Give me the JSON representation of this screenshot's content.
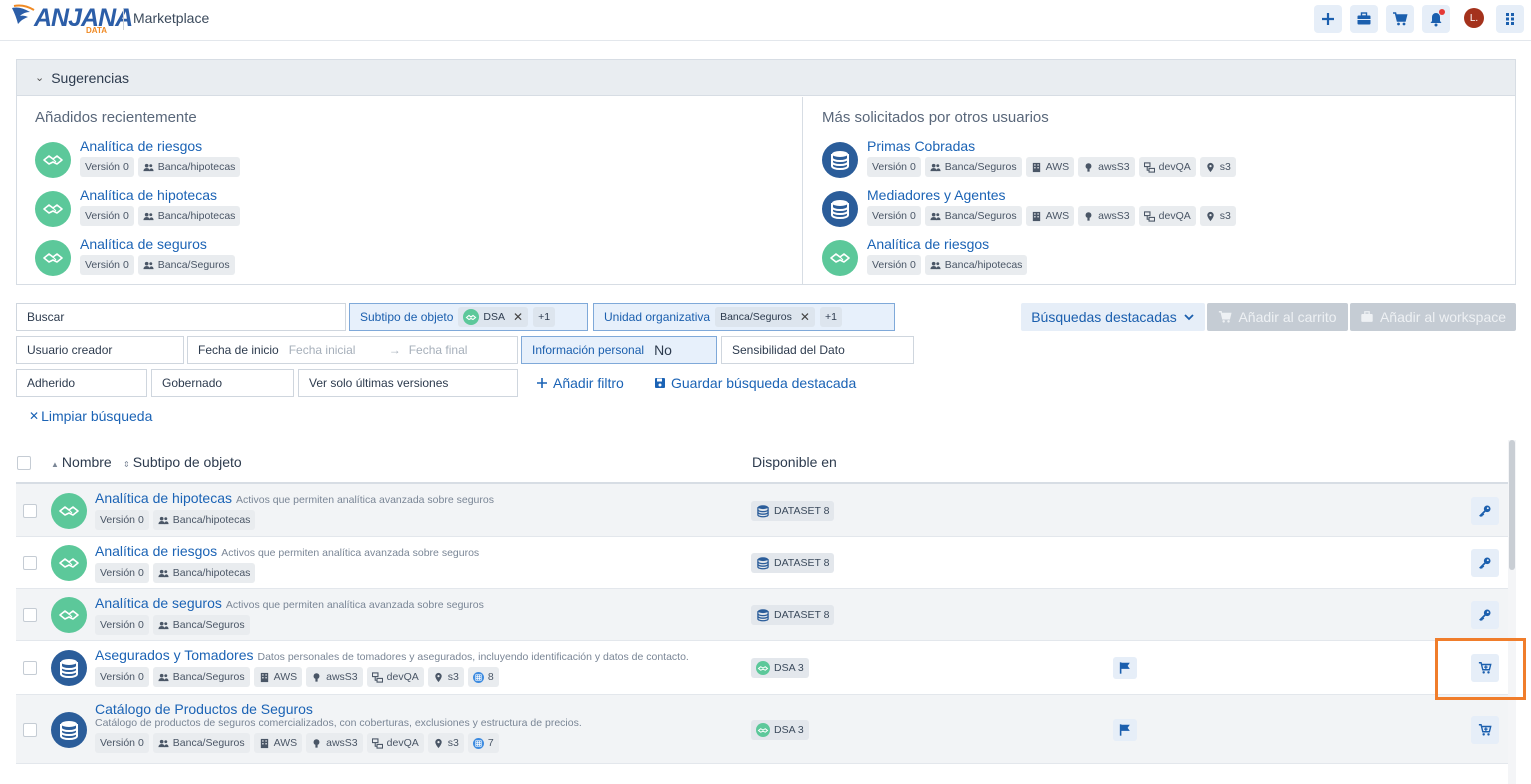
{
  "header": {
    "logo_text": "ANJANA",
    "logo_sub": "DATA",
    "app_title": "Marketplace",
    "avatar_initial": "L."
  },
  "suggestions": {
    "heading": "Sugerencias",
    "recent": {
      "title": "Añadidos recientemente",
      "items": [
        {
          "name": "Analítica de riesgos",
          "icon": "handshake-icon",
          "chips": [
            {
              "icon": "",
              "text": "Versión 0"
            },
            {
              "icon": "group-icon",
              "text": "Banca/hipotecas"
            }
          ]
        },
        {
          "name": "Analítica de hipotecas",
          "icon": "handshake-icon",
          "chips": [
            {
              "icon": "",
              "text": "Versión 0"
            },
            {
              "icon": "group-icon",
              "text": "Banca/hipotecas"
            }
          ]
        },
        {
          "name": "Analítica de seguros",
          "icon": "handshake-icon",
          "chips": [
            {
              "icon": "",
              "text": "Versión 0"
            },
            {
              "icon": "group-icon",
              "text": "Banca/Seguros"
            }
          ]
        }
      ]
    },
    "popular": {
      "title": "Más solicitados por otros usuarios",
      "items": [
        {
          "name": "Primas Cobradas",
          "icon": "database-icon",
          "chips": [
            {
              "icon": "",
              "text": "Versión 0"
            },
            {
              "icon": "group-icon",
              "text": "Banca/Seguros"
            },
            {
              "icon": "building-icon",
              "text": "AWS"
            },
            {
              "icon": "bulb-icon",
              "text": "awsS3"
            },
            {
              "icon": "network-icon",
              "text": "devQA"
            },
            {
              "icon": "pin-icon",
              "text": "s3"
            }
          ]
        },
        {
          "name": "Mediadores y Agentes",
          "icon": "database-icon",
          "chips": [
            {
              "icon": "",
              "text": "Versión 0"
            },
            {
              "icon": "group-icon",
              "text": "Banca/Seguros"
            },
            {
              "icon": "building-icon",
              "text": "AWS"
            },
            {
              "icon": "bulb-icon",
              "text": "awsS3"
            },
            {
              "icon": "network-icon",
              "text": "devQA"
            },
            {
              "icon": "pin-icon",
              "text": "s3"
            }
          ]
        },
        {
          "name": "Analítica de riesgos",
          "icon": "handshake-icon",
          "chips": [
            {
              "icon": "",
              "text": "Versión 0"
            },
            {
              "icon": "group-icon",
              "text": "Banca/hipotecas"
            }
          ]
        }
      ]
    }
  },
  "filters": {
    "search": "Buscar",
    "subtype": {
      "label": "Subtipo de objeto",
      "value": "DSA",
      "more": "+1"
    },
    "org_unit": {
      "label": "Unidad organizativa",
      "value": "Banca/Seguros",
      "more": "+1"
    },
    "creator": "Usuario creador",
    "start_date": {
      "label": "Fecha de inicio",
      "from_placeholder": "Fecha inicial",
      "arrow": "→",
      "to_placeholder": "Fecha final"
    },
    "personal_info": {
      "label": "Información personal",
      "value": "No"
    },
    "sensitivity": "Sensibilidad del Dato",
    "adhered": "Adherido",
    "governed": "Gobernado",
    "latest_versions": "Ver solo últimas versiones",
    "add_filter": "Añadir filtro",
    "save_search": "Guardar búsqueda destacada",
    "clear_search": "Limpiar búsqueda"
  },
  "actions": {
    "featured": "Búsquedas destacadas",
    "add_cart": "Añadir al carrito",
    "add_workspace": "Añadir al workspace"
  },
  "table": {
    "columns": {
      "name": "Nombre",
      "subtype": "Subtipo de objeto",
      "available": "Disponible en"
    },
    "rows": [
      {
        "name": "Analítica de hipotecas",
        "desc": "Activos que permiten analítica avanzada sobre seguros",
        "icon": "handshake-icon",
        "chips": [
          {
            "icon": "",
            "text": "Versión 0"
          },
          {
            "icon": "group-icon",
            "text": "Banca/hipotecas"
          }
        ],
        "available": "DATASET 8",
        "avail_icon": "database-icon",
        "flag": false,
        "action": "key-icon"
      },
      {
        "name": "Analítica de riesgos",
        "desc": "Activos que permiten analítica avanzada sobre seguros",
        "icon": "handshake-icon",
        "chips": [
          {
            "icon": "",
            "text": "Versión 0"
          },
          {
            "icon": "group-icon",
            "text": "Banca/hipotecas"
          }
        ],
        "available": "DATASET 8",
        "avail_icon": "database-icon",
        "flag": false,
        "action": "key-icon"
      },
      {
        "name": "Analítica de seguros",
        "desc": "Activos que permiten analítica avanzada sobre seguros",
        "icon": "handshake-icon",
        "chips": [
          {
            "icon": "",
            "text": "Versión 0"
          },
          {
            "icon": "group-icon",
            "text": "Banca/Seguros"
          }
        ],
        "available": "DATASET 8",
        "avail_icon": "database-icon",
        "flag": false,
        "action": "key-icon"
      },
      {
        "name": "Asegurados y Tomadores",
        "desc": "Datos personales de tomadores y asegurados, incluyendo identificación y datos de contacto.",
        "icon": "database-icon",
        "chips": [
          {
            "icon": "",
            "text": "Versión 0"
          },
          {
            "icon": "group-icon",
            "text": "Banca/Seguros"
          },
          {
            "icon": "building-icon",
            "text": "AWS"
          },
          {
            "icon": "bulb-icon",
            "text": "awsS3"
          },
          {
            "icon": "network-icon",
            "text": "devQA"
          },
          {
            "icon": "pin-icon",
            "text": "s3"
          },
          {
            "icon": "table-icon",
            "text": "8"
          }
        ],
        "available": "DSA 3",
        "avail_icon": "handshake-icon",
        "flag": true,
        "action": "cart-icon"
      },
      {
        "name": "Catálogo de Productos de Seguros",
        "desc": "Catálogo de productos de seguros comercializados, con coberturas, exclusiones y estructura de precios.",
        "icon": "database-icon",
        "chips": [
          {
            "icon": "",
            "text": "Versión 0"
          },
          {
            "icon": "group-icon",
            "text": "Banca/Seguros"
          },
          {
            "icon": "building-icon",
            "text": "AWS"
          },
          {
            "icon": "bulb-icon",
            "text": "awsS3"
          },
          {
            "icon": "network-icon",
            "text": "devQA"
          },
          {
            "icon": "pin-icon",
            "text": "s3"
          },
          {
            "icon": "table-icon",
            "text": "7"
          }
        ],
        "available": "DSA 3",
        "avail_icon": "handshake-icon",
        "flag": true,
        "action": "cart-icon"
      }
    ]
  },
  "colors": {
    "accent": "#1b63b5",
    "green_icon": "#5cc89a",
    "blue_icon": "#2b5d9a",
    "highlight": "#f07d2b"
  }
}
